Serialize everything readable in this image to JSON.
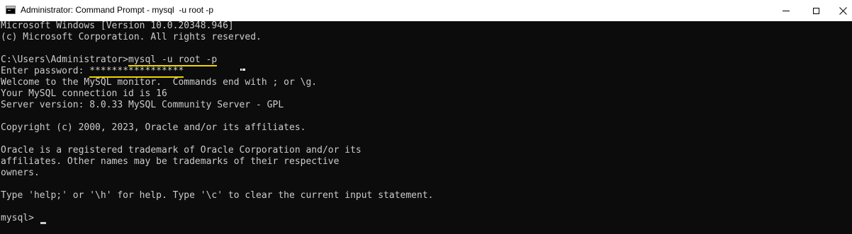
{
  "window": {
    "title": "Administrator: Command Prompt - mysql  -u root -p",
    "icon": "cmd-icon",
    "controls": {
      "minimize": "minimize-icon",
      "maximize": "maximize-icon",
      "close": "close-icon"
    }
  },
  "console": {
    "lines": [
      "Microsoft Windows [Version 10.0.20348.946]",
      "(c) Microsoft Corporation. All rights reserved.",
      "",
      "C:\\Users\\Administrator>",
      "Enter password: ",
      "Welcome to the MySQL monitor.  Commands end with ; or \\g.",
      "Your MySQL connection id is 16",
      "Server version: 8.0.33 MySQL Community Server - GPL",
      "",
      "Copyright (c) 2000, 2023, Oracle and/or its affiliates.",
      "",
      "Oracle is a registered trademark of Oracle Corporation and/or its",
      "affiliates. Other names may be trademarks of their respective",
      "owners.",
      "",
      "Type 'help;' or '\\h' for help. Type '\\c' to clear the current input statement.",
      "",
      "mysql> "
    ],
    "command": "mysql -u root -p",
    "password_mask": "*****************",
    "highlight_color": "#f0d400",
    "text_color": "#cccccc",
    "background": "#0c0c0c"
  }
}
